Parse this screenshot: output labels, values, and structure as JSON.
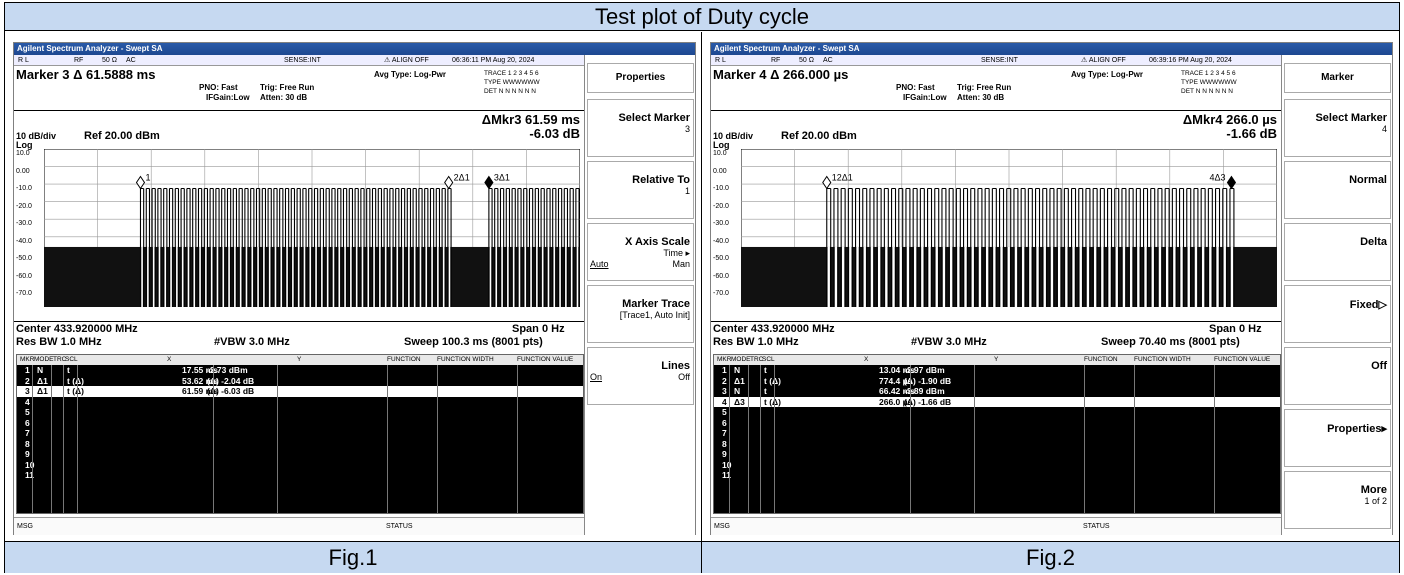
{
  "page_title": "Test plot of Duty cycle",
  "captions": [
    "Fig.1",
    "Fig.2"
  ],
  "figures": [
    {
      "app_title": "Agilent Spectrum Analyzer - Swept SA",
      "status": {
        "rl": "R L",
        "rf": "RF",
        "imp": "50 Ω",
        "ac": "AC",
        "sense": "SENSE:INT",
        "align": "ALIGN OFF",
        "time": "06:36:11 PM Aug 20, 2024"
      },
      "marker_readout": "Marker 3 Δ 61.5888 ms",
      "pno": "PNO: Fast",
      "ifgain": "IFGain:Low",
      "trig": "Trig: Free Run",
      "atten": "Atten: 30 dB",
      "avg_type": "Avg Type: Log-Pwr",
      "trace_info": "TRACE 1 2 3 4 5 6",
      "type_info": "TYPE WWWWWW",
      "det_info": "DET N N N N N N",
      "mkr_delta_1": "ΔMkr3 61.59 ms",
      "mkr_delta_2": "-6.03 dB",
      "scale": "10 dB/div",
      "ref": "Ref 20.00 dBm",
      "log": "Log",
      "yticks": [
        "10.0",
        "0.00",
        "-10.0",
        "-20.0",
        "-30.0",
        "-40.0",
        "-50.0",
        "-60.0",
        "-70.0"
      ],
      "center": "Center 433.920000 MHz",
      "span": "Span 0 Hz",
      "resbw": "Res BW 1.0 MHz",
      "vbw": "#VBW 3.0 MHz",
      "sweep": "Sweep  100.3 ms (8001 pts)",
      "markers_plot": [
        {
          "label": "1"
        },
        {
          "label": "2Δ1"
        },
        {
          "label": "3Δ1"
        }
      ],
      "table_headers": [
        "MKR",
        "MODE",
        "TRC",
        "SCL",
        "X",
        "Y",
        "FUNCTION",
        "FUNCTION WIDTH",
        "FUNCTION VALUE"
      ],
      "table_rows": [
        {
          "n": "1",
          "mode": "N",
          "trc": "1",
          "scl": "t",
          "x": "17.55 ms",
          "y": "-2.73 dBm"
        },
        {
          "n": "2",
          "mode": "Δ1",
          "trc": "1",
          "scl": "t  (Δ)",
          "x": "53.62 ms",
          "y": "(Δ)      -2.04 dB"
        },
        {
          "n": "3",
          "mode": "Δ1",
          "trc": "1",
          "scl": "t  (Δ)",
          "x": "61.59 ms",
          "y": "(Δ)      -6.03 dB"
        },
        {
          "n": "4"
        },
        {
          "n": "5"
        },
        {
          "n": "6"
        },
        {
          "n": "7"
        },
        {
          "n": "8"
        },
        {
          "n": "9"
        },
        {
          "n": "10"
        },
        {
          "n": "11"
        }
      ],
      "selected_row": 2,
      "msg": "MSG",
      "status_lbl": "STATUS",
      "softkey_title": "Properties",
      "softkeys": [
        {
          "label": "Select Marker",
          "sub": "3"
        },
        {
          "label": "Relative To",
          "sub": "1"
        },
        {
          "label": "X Axis Scale",
          "sub": "Time ▸",
          "opt1": "Auto",
          "opt2": "Man"
        },
        {
          "label": "Marker Trace",
          "sub": "[Trace1, Auto Init]"
        },
        {
          "label": "Lines",
          "opt1": "On",
          "opt2": "Off"
        }
      ]
    },
    {
      "app_title": "Agilent Spectrum Analyzer - Swept SA",
      "status": {
        "rl": "R L",
        "rf": "RF",
        "imp": "50 Ω",
        "ac": "AC",
        "sense": "SENSE:INT",
        "align": "ALIGN OFF",
        "time": "06:39:16 PM Aug 20, 2024"
      },
      "marker_readout": "Marker 4 Δ 266.000 µs",
      "pno": "PNO: Fast",
      "ifgain": "IFGain:Low",
      "trig": "Trig: Free Run",
      "atten": "Atten: 30 dB",
      "avg_type": "Avg Type: Log-Pwr",
      "trace_info": "TRACE 1 2 3 4 5 6",
      "type_info": "TYPE WWWWWW",
      "det_info": "DET N N N N N N",
      "mkr_delta_1": "ΔMkr4 266.0 µs",
      "mkr_delta_2": "-1.66 dB",
      "scale": "10 dB/div",
      "ref": "Ref 20.00 dBm",
      "log": "Log",
      "yticks": [
        "10.0",
        "0.00",
        "-10.0",
        "-20.0",
        "-30.0",
        "-40.0",
        "-50.0",
        "-60.0",
        "-70.0"
      ],
      "center": "Center 433.920000 MHz",
      "span": "Span 0 Hz",
      "resbw": "Res BW 1.0 MHz",
      "vbw": "#VBW 3.0 MHz",
      "sweep": "Sweep  70.40 ms (8001 pts)",
      "markers_plot": [
        {
          "label": "12Δ1"
        },
        {
          "label": "4Δ3"
        }
      ],
      "table_headers": [
        "MKR",
        "MODE",
        "TRC",
        "SCL",
        "X",
        "Y",
        "FUNCTION",
        "FUNCTION WIDTH",
        "FUNCTION VALUE"
      ],
      "table_rows": [
        {
          "n": "1",
          "mode": "N",
          "trc": "1",
          "scl": "t",
          "x": "13.04 ms",
          "y": "-2.97 dBm"
        },
        {
          "n": "2",
          "mode": "Δ1",
          "trc": "1",
          "scl": "t  (Δ)",
          "x": "774.4 µs",
          "y": "(Δ)      -1.90 dB"
        },
        {
          "n": "3",
          "mode": "N",
          "trc": "1",
          "scl": "t",
          "x": "66.42 ms",
          "y": "-3.89 dBm"
        },
        {
          "n": "4",
          "mode": "Δ3",
          "trc": "1",
          "scl": "t  (Δ)",
          "x": "266.0 µs",
          "y": "(Δ)      -1.66 dB"
        },
        {
          "n": "5"
        },
        {
          "n": "6"
        },
        {
          "n": "7"
        },
        {
          "n": "8"
        },
        {
          "n": "9"
        },
        {
          "n": "10"
        },
        {
          "n": "11"
        }
      ],
      "selected_row": 3,
      "msg": "MSG",
      "status_lbl": "STATUS",
      "softkey_title": "Marker",
      "softkeys": [
        {
          "label": "Select Marker",
          "sub": "4"
        },
        {
          "label": "Normal"
        },
        {
          "label": "Delta"
        },
        {
          "label": "Fixed▷"
        },
        {
          "label": "Off"
        },
        {
          "label": "Properties▸"
        },
        {
          "label": "More",
          "sub": "1 of 2"
        }
      ]
    }
  ]
}
